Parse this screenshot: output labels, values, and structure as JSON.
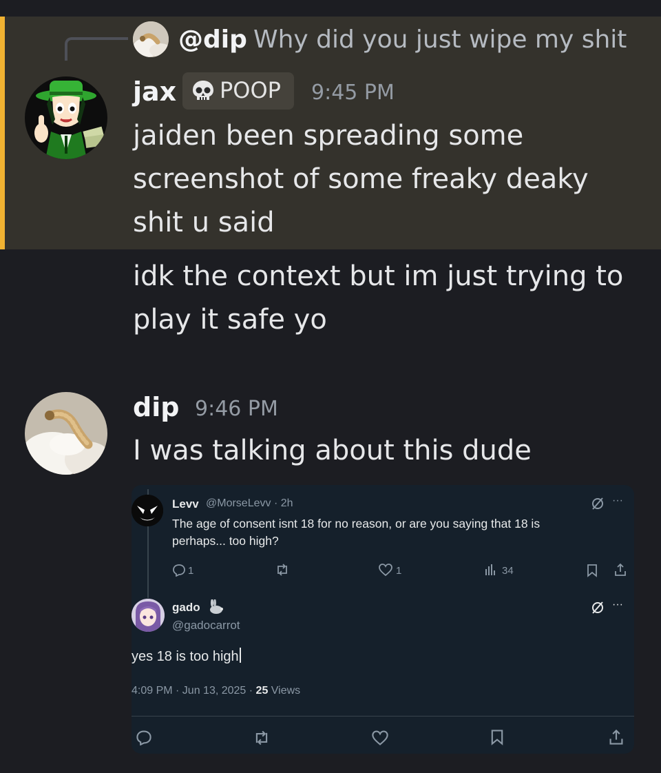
{
  "reply": {
    "mention": "@dip",
    "preview": "Why did you just wipe my shit"
  },
  "message1": {
    "author": "jax",
    "tag_label": "POOP",
    "tag_icon": "skull-icon",
    "timestamp": "9:45 PM",
    "lines": [
      "jaiden been spreading some",
      "screenshot of some freaky deaky",
      "shit u said"
    ]
  },
  "message1_followup": {
    "lines": [
      "idk the context but im just trying to",
      "play it safe yo"
    ]
  },
  "message2": {
    "author": "dip",
    "timestamp": "9:46 PM",
    "text": "I was talking about this dude"
  },
  "embed": {
    "tweet1": {
      "name": "Levv",
      "handle_time": "@MorseLevv · 2h",
      "body_lines": [
        "The age of consent isnt 18 for no reason, or are you saying that 18 is",
        "perhaps... too high?"
      ],
      "reply_count": "1",
      "like_count": "1",
      "view_count": "34"
    },
    "tweet2": {
      "name": "gado",
      "handle": "@gadocarrot",
      "body": "yes 18 is too high",
      "date": "4:09 PM · Jun 13, 2025 · ",
      "views_count": "25",
      "views_label": " Views"
    }
  },
  "colors": {
    "mention_highlight": "#34322c",
    "mention_bar": "#f0b232",
    "background": "#1c1d22",
    "tweet_bg": "#15202b"
  }
}
